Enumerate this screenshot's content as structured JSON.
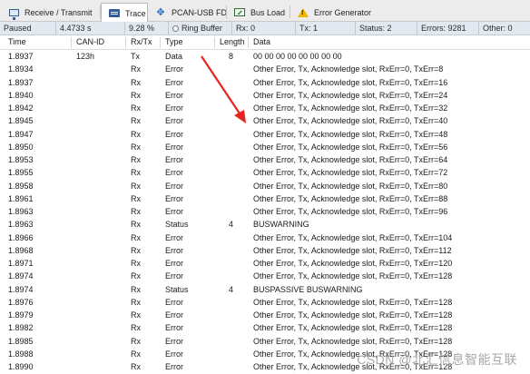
{
  "tabs": [
    {
      "label": "Receive / Transmit",
      "icon": "monitor-icon",
      "active": false
    },
    {
      "label": "Trace",
      "icon": "trace-icon",
      "active": true
    },
    {
      "label": "PCAN-USB FD",
      "icon": "usb-icon",
      "active": false
    },
    {
      "label": "Bus Load",
      "icon": "bus-load-icon",
      "active": false
    },
    {
      "label": "Error Generator",
      "icon": "warning-icon",
      "active": false
    }
  ],
  "status": {
    "state": "Paused",
    "time": "4.4733 s",
    "percent": "9.28 %",
    "ring_buffer": "Ring Buffer",
    "rx": "Rx: 0",
    "tx": "Tx: 1",
    "status": "Status: 2",
    "errors": "Errors: 9281",
    "other": "Other: 0"
  },
  "columns": [
    "Time",
    "CAN-ID",
    "Rx/Tx",
    "Type",
    "Length",
    "Data"
  ],
  "rows": [
    [
      "1.8937",
      "123h",
      "Tx",
      "Data",
      "8",
      "00 00 00 00 00 00 00 00"
    ],
    [
      "1.8934",
      "",
      "Rx",
      "Error",
      "",
      "Other Error, Tx, Acknowledge slot, RxErr=0, TxErr=8"
    ],
    [
      "1.8937",
      "",
      "Rx",
      "Error",
      "",
      "Other Error, Tx, Acknowledge slot, RxErr=0, TxErr=16"
    ],
    [
      "1.8940",
      "",
      "Rx",
      "Error",
      "",
      "Other Error, Tx, Acknowledge slot, RxErr=0, TxErr=24"
    ],
    [
      "1.8942",
      "",
      "Rx",
      "Error",
      "",
      "Other Error, Tx, Acknowledge slot, RxErr=0, TxErr=32"
    ],
    [
      "1.8945",
      "",
      "Rx",
      "Error",
      "",
      "Other Error, Tx, Acknowledge slot, RxErr=0, TxErr=40"
    ],
    [
      "1.8947",
      "",
      "Rx",
      "Error",
      "",
      "Other Error, Tx, Acknowledge slot, RxErr=0, TxErr=48"
    ],
    [
      "1.8950",
      "",
      "Rx",
      "Error",
      "",
      "Other Error, Tx, Acknowledge slot, RxErr=0, TxErr=56"
    ],
    [
      "1.8953",
      "",
      "Rx",
      "Error",
      "",
      "Other Error, Tx, Acknowledge slot, RxErr=0, TxErr=64"
    ],
    [
      "1.8955",
      "",
      "Rx",
      "Error",
      "",
      "Other Error, Tx, Acknowledge slot, RxErr=0, TxErr=72"
    ],
    [
      "1.8958",
      "",
      "Rx",
      "Error",
      "",
      "Other Error, Tx, Acknowledge slot, RxErr=0, TxErr=80"
    ],
    [
      "1.8961",
      "",
      "Rx",
      "Error",
      "",
      "Other Error, Tx, Acknowledge slot, RxErr=0, TxErr=88"
    ],
    [
      "1.8963",
      "",
      "Rx",
      "Error",
      "",
      "Other Error, Tx, Acknowledge slot, RxErr=0, TxErr=96"
    ],
    [
      "1.8963",
      "",
      "Rx",
      "Status",
      "4",
      "BUSWARNING"
    ],
    [
      "1.8966",
      "",
      "Rx",
      "Error",
      "",
      "Other Error, Tx, Acknowledge slot, RxErr=0, TxErr=104"
    ],
    [
      "1.8968",
      "",
      "Rx",
      "Error",
      "",
      "Other Error, Tx, Acknowledge slot, RxErr=0, TxErr=112"
    ],
    [
      "1.8971",
      "",
      "Rx",
      "Error",
      "",
      "Other Error, Tx, Acknowledge slot, RxErr=0, TxErr=120"
    ],
    [
      "1.8974",
      "",
      "Rx",
      "Error",
      "",
      "Other Error, Tx, Acknowledge slot, RxErr=0, TxErr=128"
    ],
    [
      "1.8974",
      "",
      "Rx",
      "Status",
      "4",
      "BUSPASSIVE BUSWARNING"
    ],
    [
      "1.8976",
      "",
      "Rx",
      "Error",
      "",
      "Other Error, Tx, Acknowledge slot, RxErr=0, TxErr=128"
    ],
    [
      "1.8979",
      "",
      "Rx",
      "Error",
      "",
      "Other Error, Tx, Acknowledge slot, RxErr=0, TxErr=128"
    ],
    [
      "1.8982",
      "",
      "Rx",
      "Error",
      "",
      "Other Error, Tx, Acknowledge slot, RxErr=0, TxErr=128"
    ],
    [
      "1.8985",
      "",
      "Rx",
      "Error",
      "",
      "Other Error, Tx, Acknowledge slot, RxErr=0, TxErr=128"
    ],
    [
      "1.8988",
      "",
      "Rx",
      "Error",
      "",
      "Other Error, Tx, Acknowledge slot, RxErr=0, TxErr=128"
    ],
    [
      "1.8990",
      "",
      "Rx",
      "Error",
      "",
      "Other Error, Tx, Acknowledge slot, RxErr=0, TxErr=128"
    ]
  ],
  "watermark": "CSDN @北汇信息智能互联",
  "colors": {
    "annotation_arrow": "#e8231c",
    "active_tab": "#ffffff",
    "status_bar": "#e3e9f1"
  }
}
